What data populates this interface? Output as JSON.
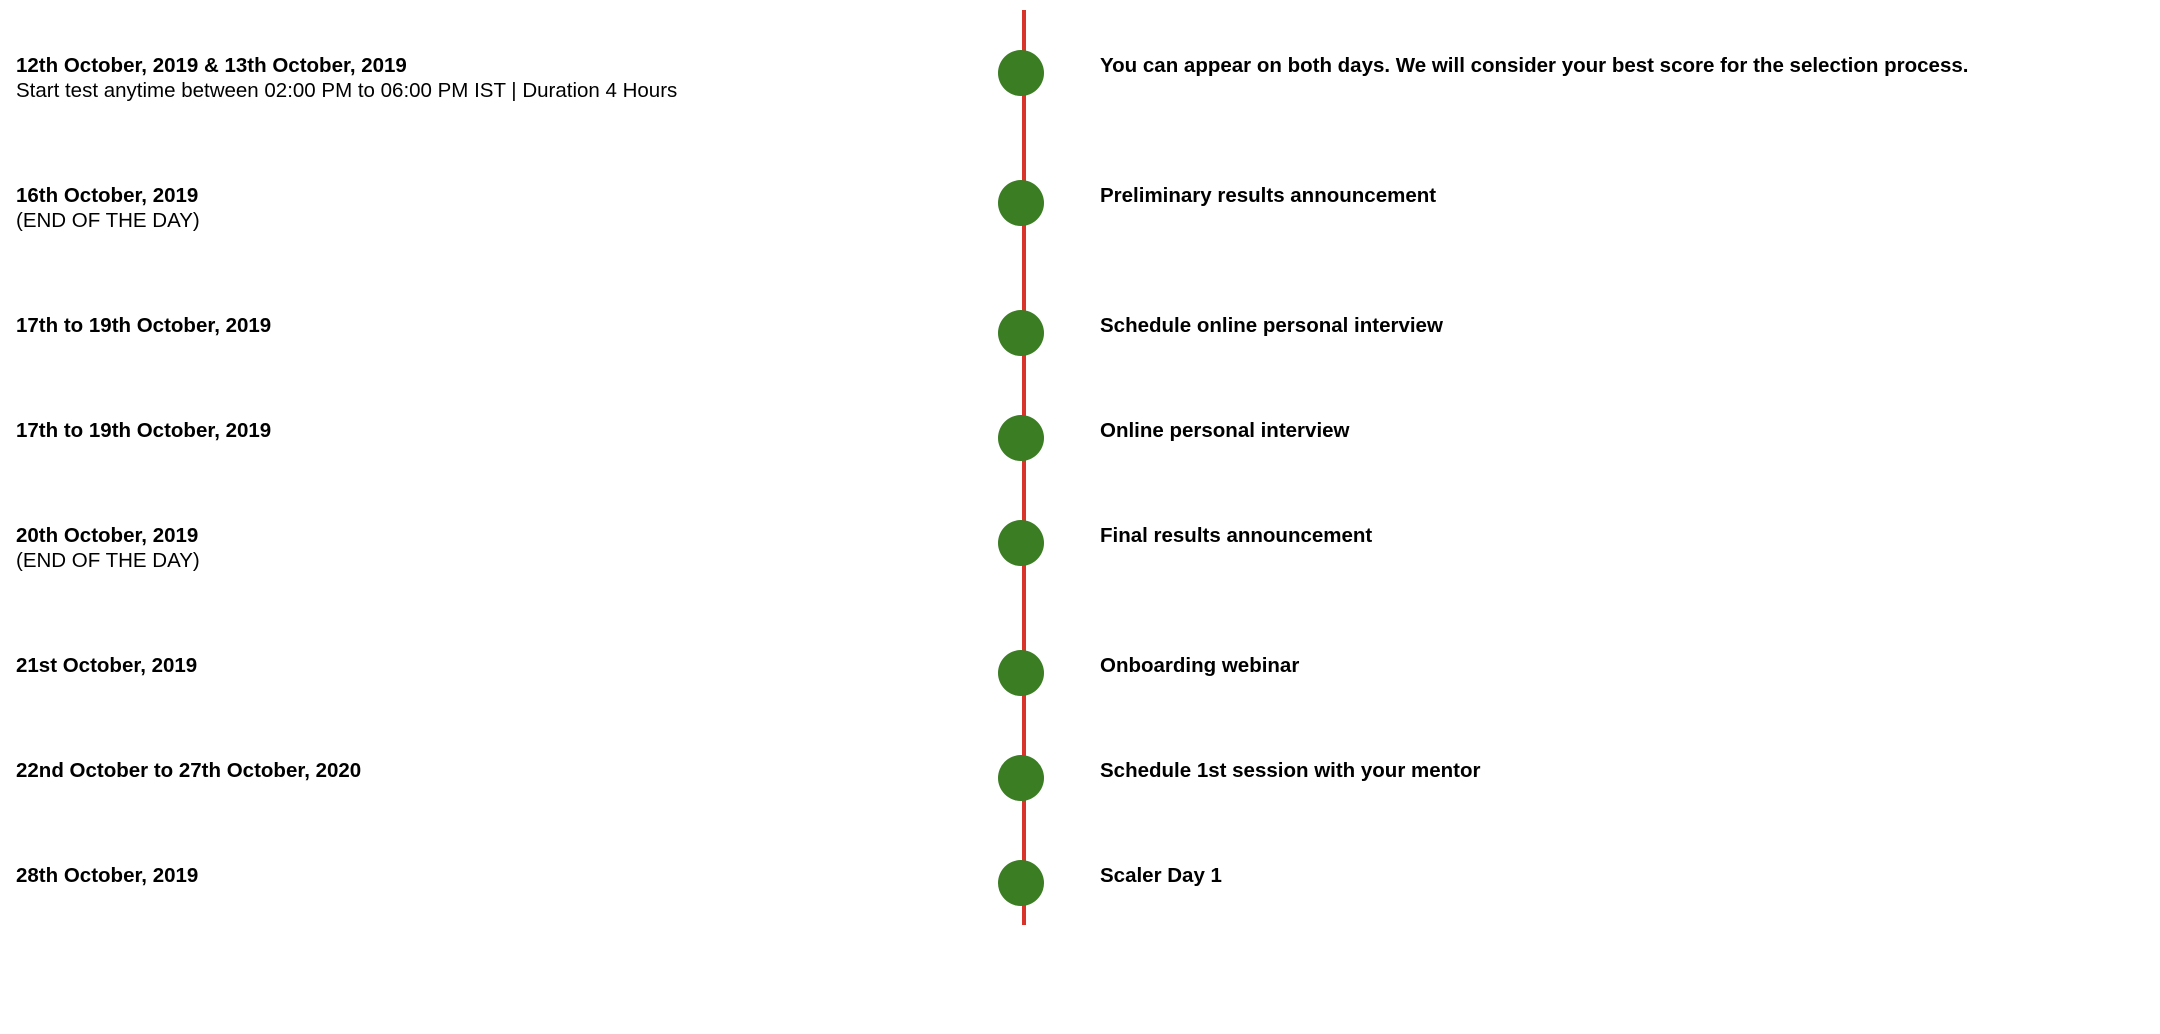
{
  "timeline": {
    "colors": {
      "spine": "#d9342b",
      "node": "#3a7d23"
    },
    "events": [
      {
        "date": "12th October, 2019 & 13th October, 2019",
        "sub": "Start test anytime between 02:00 PM to 06:00 PM IST | Duration 4 Hours",
        "description": "You can appear on both days. We will consider your best score for the selection process."
      },
      {
        "date": "16th October, 2019",
        "sub": "(END OF THE DAY)",
        "description": "Preliminary results announcement"
      },
      {
        "date": "17th to 19th October, 2019",
        "sub": "",
        "description": "Schedule online personal interview"
      },
      {
        "date": "17th to 19th October, 2019",
        "sub": "",
        "description": "Online personal interview"
      },
      {
        "date": "20th October, 2019",
        "sub": "(END OF THE DAY)",
        "description": "Final results announcement"
      },
      {
        "date": "21st October, 2019",
        "sub": "",
        "description": "Onboarding webinar"
      },
      {
        "date": "22nd October to 27th October, 2020",
        "sub": "",
        "description": "Schedule 1st session with your mentor"
      },
      {
        "date": "28th October, 2019",
        "sub": "",
        "description": "Scaler Day 1"
      }
    ]
  }
}
